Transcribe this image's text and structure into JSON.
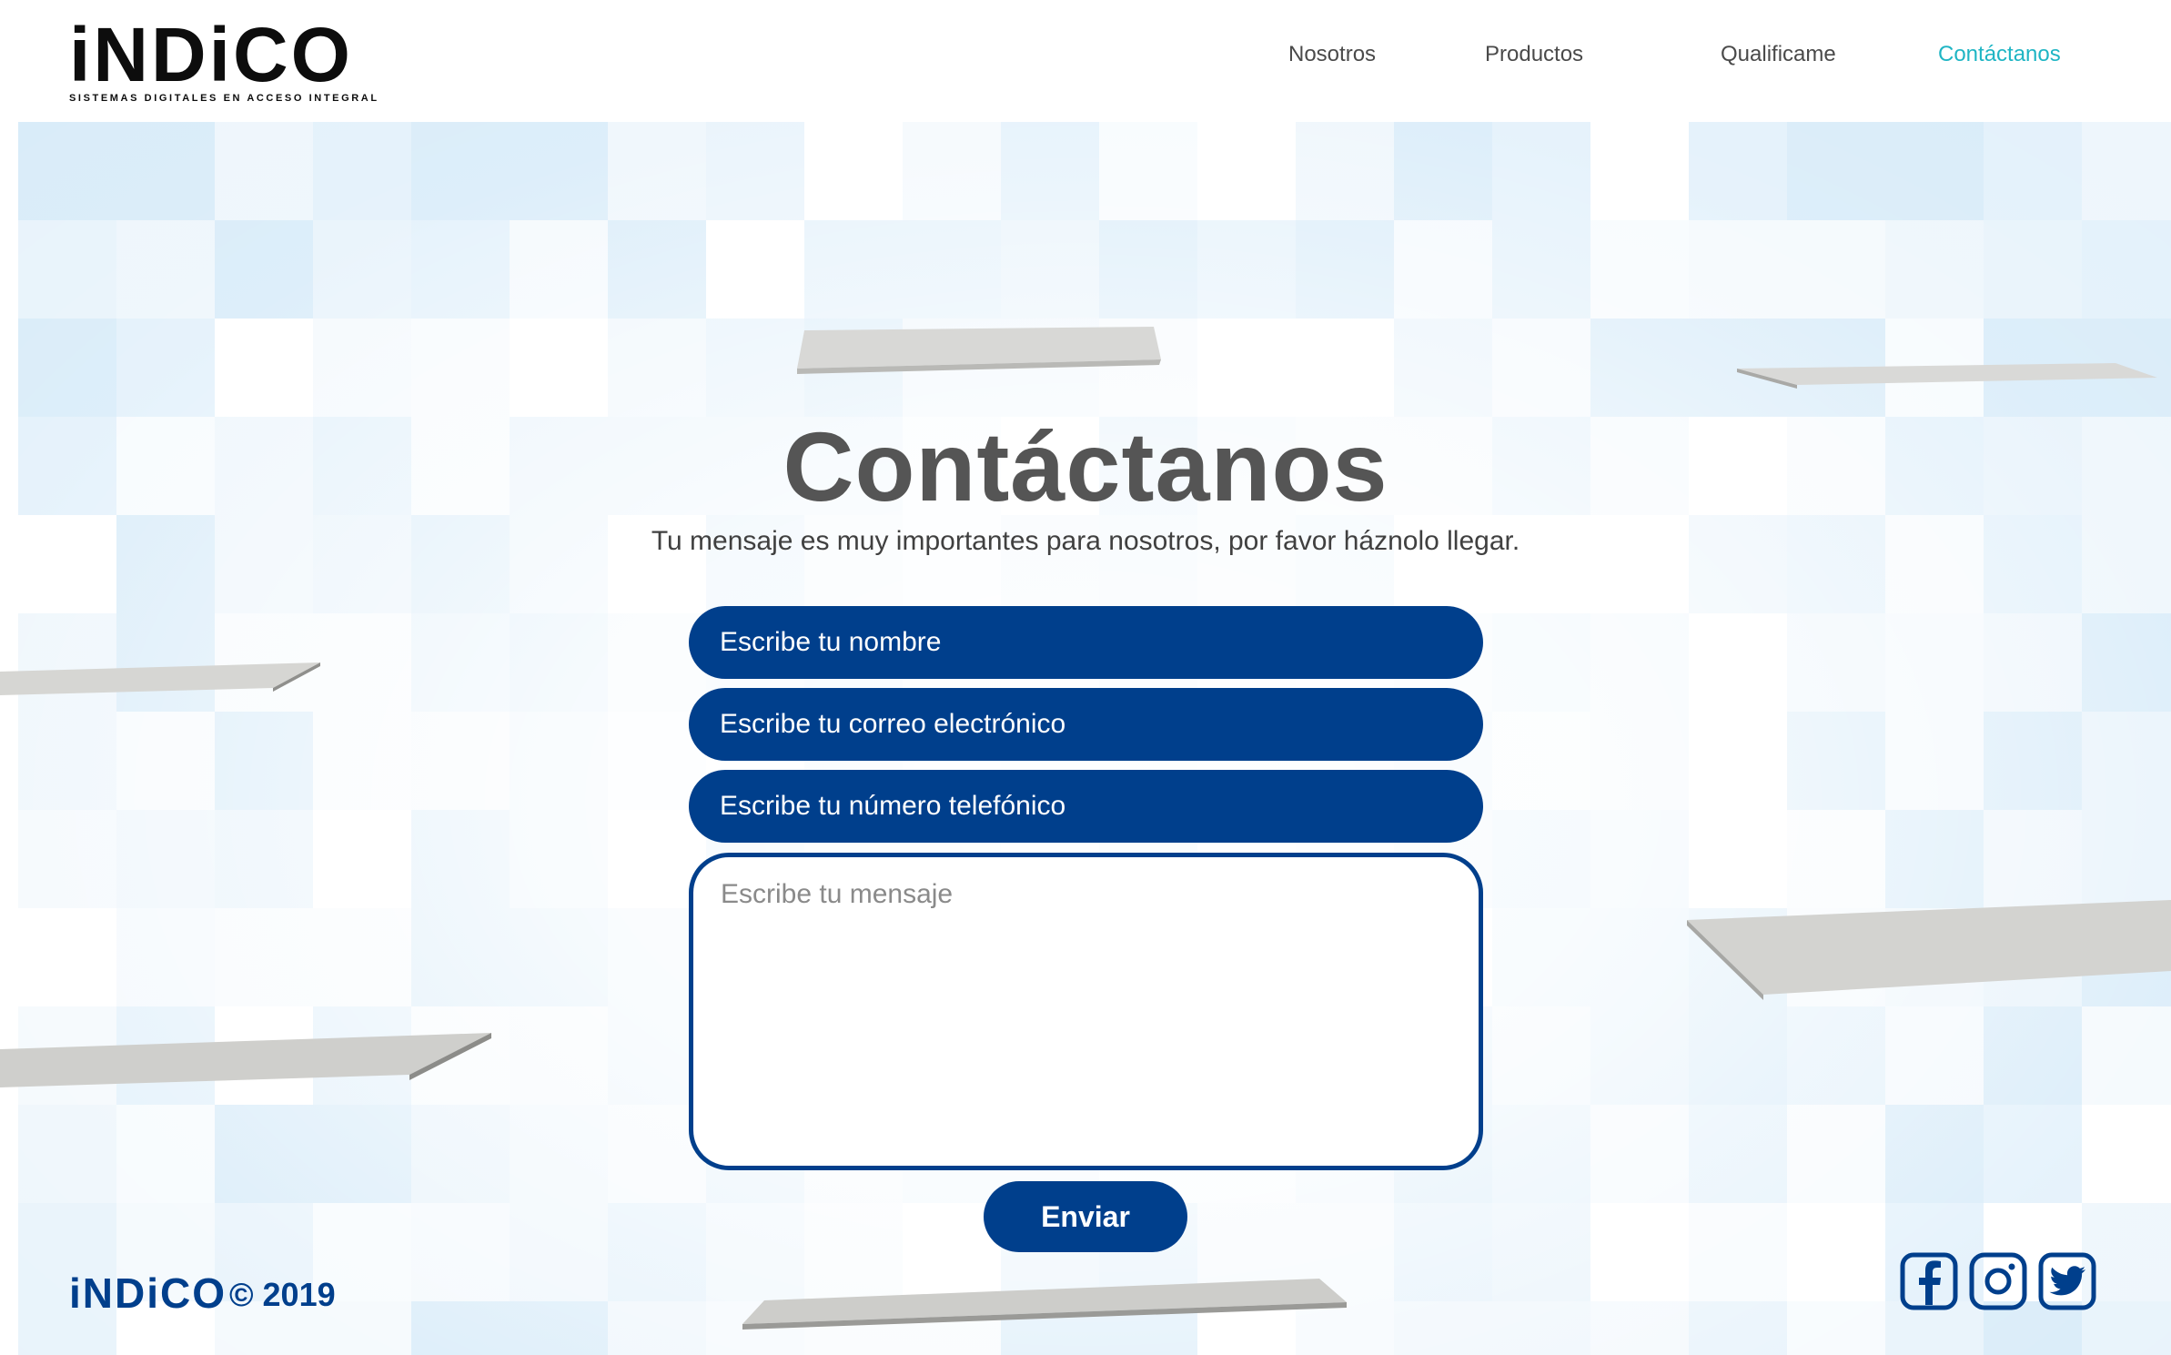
{
  "brand": {
    "name": "iNDiCO",
    "tagline": "SISTEMAS DIGITALES EN ACCESO INTEGRAL",
    "color": "#003f8c"
  },
  "nav": {
    "items": [
      {
        "label": "Nosotros"
      },
      {
        "label": "Productos"
      },
      {
        "label": "Qualificame"
      },
      {
        "label": "Contáctanos",
        "active": true
      }
    ],
    "active_color": "#1fb5c4"
  },
  "hero": {
    "title": "Contáctanos",
    "subtitle": "Tu mensaje es muy importantes para nosotros, por favor háznolo llegar."
  },
  "form": {
    "name_placeholder": "Escribe tu nombre",
    "email_placeholder": "Escribe tu correo electrónico",
    "phone_placeholder": "Escribe tu número telefónico",
    "message_placeholder": "Escribe tu mensaje",
    "submit_label": "Enviar"
  },
  "footer": {
    "logo": "iNDiCO",
    "copyright": "© 2019",
    "social": [
      "facebook-icon",
      "instagram-icon",
      "twitter-icon"
    ]
  }
}
